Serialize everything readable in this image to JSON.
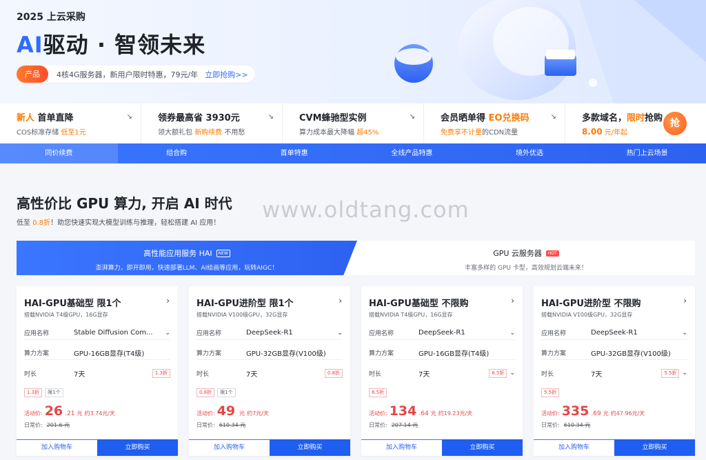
{
  "hero": {
    "kicker": "2025 上云采购",
    "title_ai": "AI",
    "title_rest": "驱动 · 智领未来",
    "promo_tag": "产品",
    "promo_text": "4核4G服务器，新用户限时特惠，79元/年",
    "promo_link": "立即抢购>>"
  },
  "strip": {
    "c1": {
      "h1": "新人",
      "h2": " 首单直降",
      "s1": "COS标准存储 ",
      "s2": "低至1元"
    },
    "c2": {
      "h1": "领券最高省 3930元",
      "s1": "领大额礼包 ",
      "s2": "新购续费",
      "s3": " 不用愁"
    },
    "c3": {
      "h1": "CVM蜂驰型实例",
      "s1": "算力成本最大降幅 ",
      "s2": "超45%"
    },
    "c4": {
      "h1": "会员晒单得 ",
      "h2": "EO兑换码",
      "s1": "免费享不计量",
      "s2": "的CDN流量"
    },
    "c5": {
      "h1": "多款域名，",
      "h2": "限时",
      "h3": "抢购",
      "s1": "8.00",
      "s2": " 元/年起",
      "badge": "抢"
    }
  },
  "nav": [
    "同价续费",
    "组合购",
    "首单特惠",
    "全线产品特惠",
    "境外优选",
    "热门上云场景"
  ],
  "section": {
    "title": "高性价比 GPU 算力, 开启 AI 时代",
    "sub1": "低至 ",
    "sub2": "0.8折",
    "sub3": "！助您快速实现大模型训练与推理，轻松搭建 AI 应用！",
    "watermark": "www.oldtang.com"
  },
  "tabs": {
    "hai": {
      "title": "高性能应用服务 HAI",
      "badge": "NEW",
      "desc": "澎湃算力，即开即用，快速部署LLM、AI绘画等应用，玩转AIGC！"
    },
    "gpu": {
      "title": "GPU 云服务器",
      "badge": "HOT",
      "desc": "丰富多样的 GPU 卡型，高效规划云端未来！"
    }
  },
  "labels": {
    "app": "应用名称",
    "plan": "算力方案",
    "dur": "时长",
    "act": "活动价:",
    "orig": "日常价:",
    "cart": "加入购物车",
    "buy": "立即购买",
    "yuan": "元"
  },
  "cards": [
    {
      "title": "HAI-GPU基础型 限1个",
      "desc": "搭载NVIDIA T4级GPU，16G显存",
      "app": "Stable Diffusion Com...",
      "plan": "GPU-16GB显存(T4级)",
      "dur": "7天",
      "disc": "1.3折",
      "chips": [
        "1.3折",
        "限1个"
      ],
      "int": "26",
      "dec": ".21",
      "per": "约3.74元/天",
      "orig": "201.6 元"
    },
    {
      "title": "HAI-GPU进阶型 限1个",
      "desc": "搭载NVIDIA V100级GPU，32G显存",
      "app": "DeepSeek-R1",
      "plan": "GPU-32GB显存(V100级)",
      "dur": "7天",
      "disc": "0.8折",
      "chips": [
        "0.8折",
        "限1个"
      ],
      "int": "49",
      "dec": "",
      "per": "约7元/天",
      "orig": "610.34 元"
    },
    {
      "title": "HAI-GPU基础型 不限购",
      "desc": "搭载NVIDIA T4级GPU，16G显存",
      "app": "DeepSeek-R1",
      "plan": "GPU-16GB显存(T4级)",
      "dur": "7天",
      "disc": "6.5折",
      "chips": [
        "6.5折"
      ],
      "int": "134",
      "dec": ".64",
      "per": "约19.23元/天",
      "orig": "207.14 元"
    },
    {
      "title": "HAI-GPU进阶型 不限购",
      "desc": "搭载NVIDIA V100级GPU，32G显存",
      "app": "DeepSeek-R1",
      "plan": "GPU-32GB显存(V100级)",
      "dur": "7天",
      "disc": "5.5折",
      "chips": [
        "5.5折"
      ],
      "int": "335",
      "dec": ".69",
      "per": "约47.96元/天",
      "orig": "610.34 元"
    }
  ]
}
